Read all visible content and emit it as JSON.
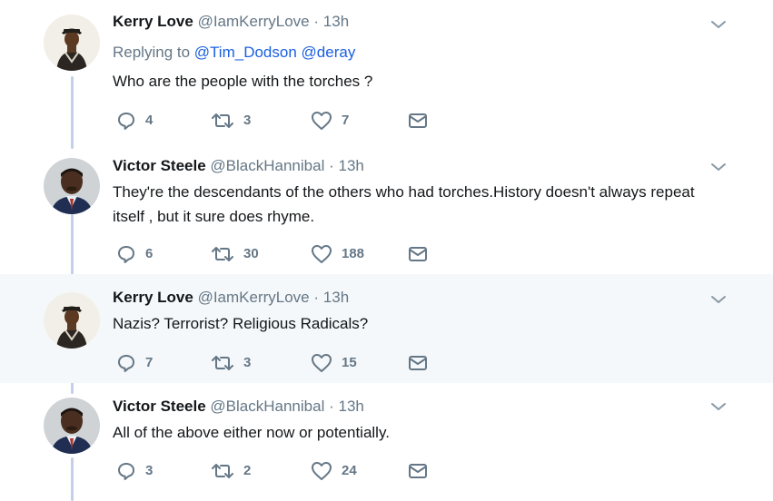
{
  "tweets": [
    {
      "name": "Kerry Love",
      "handle": "@IamKerryLove",
      "separator": "·",
      "time": "13h",
      "replying_prefix": "Replying to",
      "mentions": [
        "@Tim_Dodson",
        "@deray"
      ],
      "text": "Who are the people with the torches ?",
      "replies": "4",
      "retweets": "3",
      "likes": "7"
    },
    {
      "name": "Victor Steele",
      "handle": "@BlackHannibal",
      "separator": "·",
      "time": "13h",
      "text": "They're the descendants of the others who had torches.History doesn't always repeat itself , but it sure does rhyme.",
      "replies": "6",
      "retweets": "30",
      "likes": "188"
    },
    {
      "name": "Kerry Love",
      "handle": "@IamKerryLove",
      "separator": "·",
      "time": "13h",
      "text": "Nazis? Terrorist? Religious Radicals?",
      "replies": "7",
      "retweets": "3",
      "likes": "15"
    },
    {
      "name": "Victor Steele",
      "handle": "@BlackHannibal",
      "separator": "·",
      "time": "13h",
      "text": "All of the above either now or potentially.",
      "replies": "3",
      "retweets": "2",
      "likes": "24"
    }
  ],
  "icons": {
    "reply": "reply-icon",
    "retweet": "retweet-icon",
    "like": "heart-icon",
    "dm": "envelope-icon",
    "more": "chevron-down-icon"
  },
  "colors": {
    "text_primary": "#14171a",
    "text_secondary": "#657786",
    "link": "#1b60e0",
    "thread_line": "#c4cfea",
    "highlight_bg": "#f5f8fa"
  }
}
